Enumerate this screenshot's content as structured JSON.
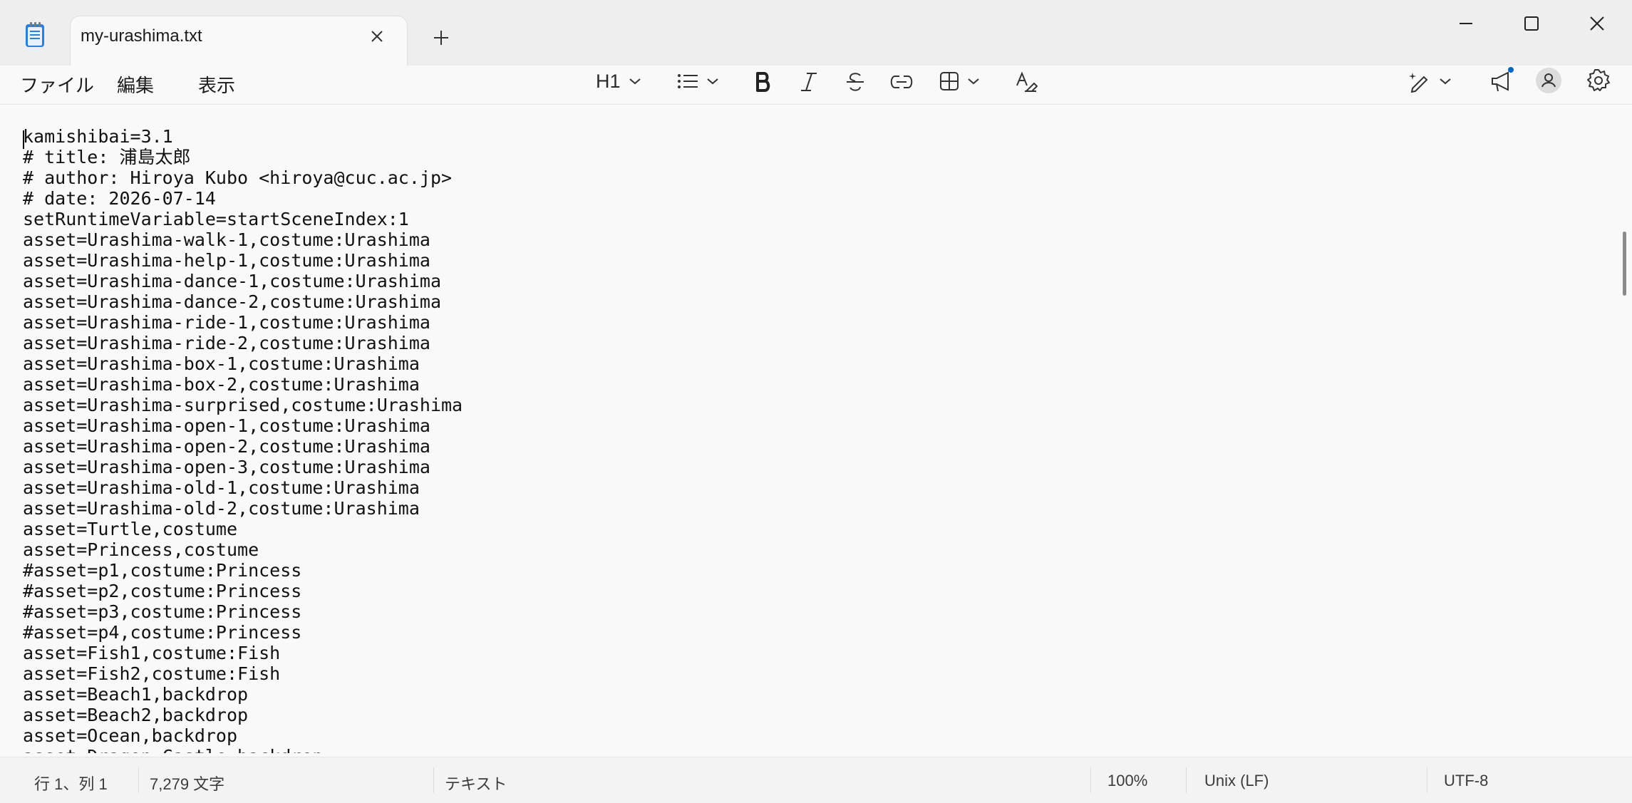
{
  "tab": {
    "title": "my-urashima.txt"
  },
  "menu": {
    "file": "ファイル",
    "edit": "編集",
    "view": "表示"
  },
  "toolbar": {
    "heading": "H1"
  },
  "editor": {
    "lines": [
      "kamishibai=3.1",
      "# title: 浦島太郎",
      "# author: Hiroya Kubo <hiroya@cuc.ac.jp>",
      "# date: 2026-07-14",
      "setRuntimeVariable=startSceneIndex:1",
      "asset=Urashima-walk-1,costume:Urashima",
      "asset=Urashima-help-1,costume:Urashima",
      "asset=Urashima-dance-1,costume:Urashima",
      "asset=Urashima-dance-2,costume:Urashima",
      "asset=Urashima-ride-1,costume:Urashima",
      "asset=Urashima-ride-2,costume:Urashima",
      "asset=Urashima-box-1,costume:Urashima",
      "asset=Urashima-box-2,costume:Urashima",
      "asset=Urashima-surprised,costume:Urashima",
      "asset=Urashima-open-1,costume:Urashima",
      "asset=Urashima-open-2,costume:Urashima",
      "asset=Urashima-open-3,costume:Urashima",
      "asset=Urashima-old-1,costume:Urashima",
      "asset=Urashima-old-2,costume:Urashima",
      "asset=Turtle,costume",
      "asset=Princess,costume",
      "#asset=p1,costume:Princess",
      "#asset=p2,costume:Princess",
      "#asset=p3,costume:Princess",
      "#asset=p4,costume:Princess",
      "asset=Fish1,costume:Fish",
      "asset=Fish2,costume:Fish",
      "asset=Beach1,backdrop",
      "asset=Beach2,backdrop",
      "asset=Ocean,backdrop",
      "asset=Dragon-Castle,backdrop"
    ]
  },
  "status": {
    "position": "行 1、列 1",
    "chars": "7,279 文字",
    "format": "テキスト",
    "zoom": "100%",
    "line_ending": "Unix (LF)",
    "encoding": "UTF-8"
  },
  "icons": {
    "app": "notepad-icon",
    "close_tab": "close-icon",
    "new_tab": "plus-icon",
    "minimize": "minimize-icon",
    "maximize": "maximize-icon",
    "close": "close-icon",
    "list": "bulleted-list-icon",
    "bold": "bold-icon",
    "italic": "italic-icon",
    "strike": "strikethrough-icon",
    "link": "link-icon",
    "table": "table-icon",
    "clear": "clear-formatting-icon",
    "copilot": "copilot-pen-icon",
    "whatsnew": "megaphone-icon",
    "account": "account-icon",
    "settings": "gear-icon"
  },
  "colors": {
    "accent": "#0067c0",
    "spell_underline": "#d13438"
  }
}
